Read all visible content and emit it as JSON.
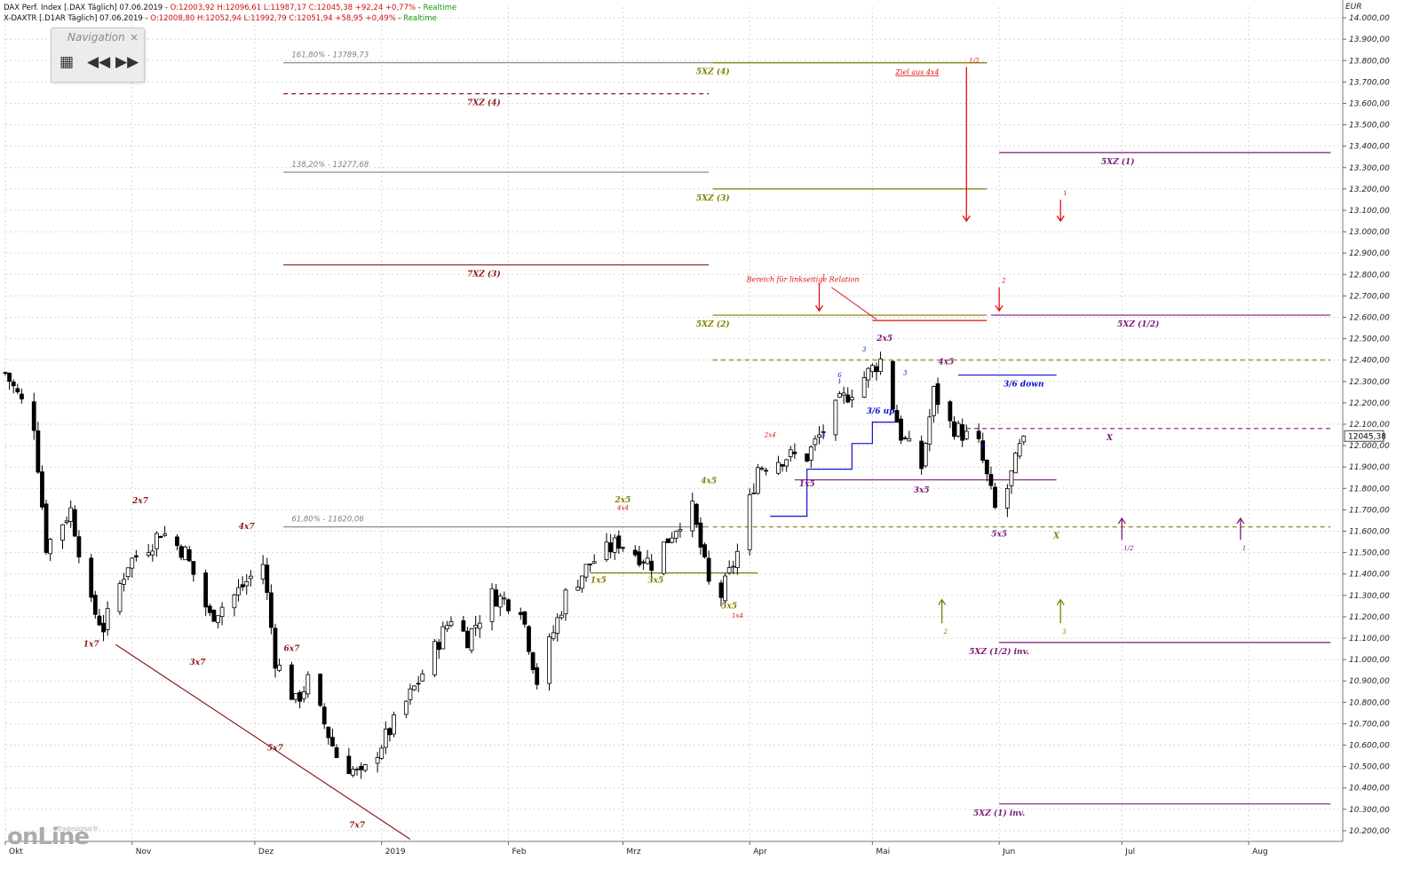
{
  "header": {
    "line1_prefix": "DAX Perf. Index [.DAX Täglich] 07.06.2019 - ",
    "line1_values": "O:12003,92 H:12096,61 L:11987,17 C:12045,38 +92,24 +0,77%",
    "line1_sep": " - ",
    "line1_status": "Realtime",
    "line2_prefix": "X-DAXTR [.D1AR Täglich] 07.06.2019 - ",
    "line2_values": "O:12008,80 H:12052,94 L:11992,79 C:12051,94 +58,95 +0,49%",
    "line2_sep": " - ",
    "line2_status": "Realtime"
  },
  "navigation": {
    "title": "Navigation",
    "close": "×",
    "grid": "▦",
    "back": "◀◀",
    "forward": "▶▶"
  },
  "logo": {
    "main": "onLine",
    "sub": "Tradesignal®"
  },
  "colors": {
    "olive": "#7f7f00",
    "darkred": "#8b1a1a",
    "purple": "#7a1a7a",
    "blue": "#1010d0",
    "red": "#e01010",
    "gray": "#808080"
  },
  "chart_data": {
    "type": "candlestick",
    "currency": "EUR",
    "current_price": "12045,38",
    "ylim": [
      10150,
      14050
    ],
    "y_ticks": [
      "10.200,00",
      "10.300,00",
      "10.400,00",
      "10.500,00",
      "10.600,00",
      "10.700,00",
      "10.800,00",
      "10.900,00",
      "11.000,00",
      "11.100,00",
      "11.200,00",
      "11.300,00",
      "11.400,00",
      "11.500,00",
      "11.600,00",
      "11.700,00",
      "11.800,00",
      "11.900,00",
      "12.000,00",
      "12.100,00",
      "12.200,00",
      "12.300,00",
      "12.400,00",
      "12.500,00",
      "12.600,00",
      "12.700,00",
      "12.800,00",
      "12.900,00",
      "13.000,00",
      "13.100,00",
      "13.200,00",
      "13.300,00",
      "13.400,00",
      "13.500,00",
      "13.600,00",
      "13.700,00",
      "13.800,00",
      "13.900,00",
      "14.000,00"
    ],
    "x_labels": [
      "Okt",
      "Nov",
      "Dez",
      "2019",
      "Feb",
      "Mrz",
      "Apr",
      "Mai",
      "Jun",
      "Jul",
      "Aug"
    ],
    "x_label_dates": [
      "2018-10-01",
      "2018-11-01",
      "2018-12-01",
      "2019-01-01",
      "2019-02-01",
      "2019-03-01",
      "2019-04-01",
      "2019-05-01",
      "2019-06-01",
      "2019-07-01",
      "2019-08-01"
    ],
    "x_range": [
      "2018-10-01",
      "2019-08-24"
    ],
    "grid": true,
    "horizontal_levels": [
      {
        "label": "161,80% - 13789,73",
        "value": 13790,
        "from": "2018-12-08",
        "to": "2019-05-29",
        "color": "gray",
        "style": "solid",
        "label_at": "2018-12-10"
      },
      {
        "label": "5XZ (4)",
        "value": 13790,
        "from": "2019-03-23",
        "to": "2019-05-29",
        "color": "olive",
        "style": "solid",
        "label_at": "2019-03-23"
      },
      {
        "label": "7XZ (4)",
        "value": 13645,
        "from": "2018-12-08",
        "to": "2019-03-22",
        "color": "darkred",
        "style": "dashed",
        "label_at": "2019-01-26"
      },
      {
        "label": "5XZ (1)",
        "value": 13370,
        "from": "2019-06-01",
        "to": "2019-08-21",
        "color": "purple",
        "style": "solid",
        "label_at": "2019-06-30"
      },
      {
        "label": "138,20% - 13277,68",
        "value": 13278,
        "from": "2018-12-08",
        "to": "2019-03-22",
        "color": "gray",
        "style": "solid",
        "label_at": "2018-12-10"
      },
      {
        "label": "5XZ (3)",
        "value": 13200,
        "from": "2019-03-23",
        "to": "2019-05-29",
        "color": "olive",
        "style": "solid",
        "label_at": "2019-03-23"
      },
      {
        "label": "7XZ (3)",
        "value": 12845,
        "from": "2018-12-08",
        "to": "2019-03-22",
        "color": "darkred",
        "style": "solid",
        "label_at": "2019-01-26"
      },
      {
        "label": "5XZ (2)",
        "value": 12610,
        "from": "2019-03-23",
        "to": "2019-05-29",
        "color": "olive",
        "style": "solid",
        "label_at": "2019-03-23"
      },
      {
        "label": "5XZ (1/2)",
        "value": 12610,
        "from": "2019-05-30",
        "to": "2019-08-21",
        "color": "purple",
        "style": "solid",
        "label_at": "2019-07-05"
      },
      {
        "label": "",
        "value": 12400,
        "from": "2019-03-23",
        "to": "2019-08-21",
        "color": "olive",
        "style": "dashed",
        "label_at": ""
      },
      {
        "label": "3/6 down",
        "value": 12330,
        "from": "2019-05-22",
        "to": "2019-06-15",
        "color": "blue",
        "style": "solid",
        "label_at": "2019-06-07"
      },
      {
        "label": "X",
        "value": 12080,
        "from": "2019-05-22",
        "to": "2019-08-21",
        "color": "purple",
        "style": "dashed",
        "label_at": "2019-06-28"
      },
      {
        "label": "",
        "value": 11840,
        "from": "2019-04-12",
        "to": "2019-06-15",
        "color": "purple",
        "style": "solid",
        "label_at": ""
      },
      {
        "label": "61,80% - 11620,06",
        "value": 11620,
        "from": "2018-12-08",
        "to": "2019-03-22",
        "color": "gray",
        "style": "solid",
        "label_at": "2018-12-10"
      },
      {
        "label": "X",
        "value": 11620,
        "from": "2019-03-23",
        "to": "2019-08-21",
        "color": "olive",
        "style": "dashed",
        "label_at": "2019-06-15"
      },
      {
        "label": "",
        "value": 11405,
        "from": "2019-02-21",
        "to": "2019-04-03",
        "color": "olive",
        "style": "solid",
        "label_at": ""
      },
      {
        "label": "5XZ (1/2) inv.",
        "value": 11080,
        "from": "2019-06-01",
        "to": "2019-08-21",
        "color": "purple",
        "style": "solid",
        "label_at": "2019-06-01"
      },
      {
        "label": "5XZ (1) inv.",
        "value": 10325,
        "from": "2019-06-01",
        "to": "2019-08-21",
        "color": "purple",
        "style": "solid",
        "label_at": "2019-06-01"
      }
    ],
    "trendline": {
      "from": [
        "2018-10-28",
        11070
      ],
      "to": [
        "2019-01-08",
        10160
      ],
      "color": "darkred"
    },
    "blue_step": [
      [
        "2019-04-06",
        11670
      ],
      [
        "2019-04-15",
        11670
      ],
      [
        "2019-04-15",
        11890
      ],
      [
        "2019-04-26",
        11890
      ],
      [
        "2019-04-26",
        12010
      ],
      [
        "2019-05-01",
        12010
      ],
      [
        "2019-05-01",
        12110
      ],
      [
        "2019-05-08",
        12110
      ]
    ],
    "red_level": {
      "from": [
        "2019-05-01",
        12585
      ],
      "to": [
        "2019-05-29",
        12585
      ]
    },
    "arrows": [
      {
        "label": "1",
        "date": "2019-04-18",
        "from": 12760,
        "to": 12630,
        "color": "red",
        "dir": "down"
      },
      {
        "label": "2",
        "date": "2019-06-01",
        "from": 12740,
        "to": 12630,
        "color": "red",
        "dir": "down"
      },
      {
        "label": "1",
        "date": "2019-06-16",
        "from": 13150,
        "to": 13050,
        "color": "red",
        "dir": "down"
      },
      {
        "label": "1/2",
        "date": "2019-05-24",
        "from": 13770,
        "to": 13050,
        "color": "red",
        "dir": "down"
      },
      {
        "label": "2",
        "date": "2019-05-18",
        "from": 11170,
        "to": 11280,
        "color": "olive",
        "dir": "up"
      },
      {
        "label": "3",
        "date": "2019-06-16",
        "from": 11170,
        "to": 11280,
        "color": "olive",
        "dir": "up"
      },
      {
        "label": "1/2",
        "date": "2019-07-01",
        "from": 11560,
        "to": 11660,
        "color": "purple",
        "dir": "up"
      },
      {
        "label": "1",
        "date": "2019-07-30",
        "from": 11560,
        "to": 11660,
        "color": "purple",
        "dir": "up"
      }
    ],
    "annotations": [
      {
        "text": "Ziel aus 4x4",
        "date": "2019-05-12",
        "value": 13735,
        "color": "red",
        "underline": true,
        "size": 8
      },
      {
        "text": "Bereich für linkseitige Relation",
        "date": "2019-04-14",
        "value": 12765,
        "color": "red",
        "size": 8
      },
      {
        "text": "2x7",
        "date": "2018-11-03",
        "value": 11730,
        "color": "darkred",
        "size": 9
      },
      {
        "text": "4x7",
        "date": "2018-11-29",
        "value": 11610,
        "color": "darkred",
        "size": 9
      },
      {
        "text": "1x7",
        "date": "2018-10-22",
        "value": 11060,
        "color": "darkred",
        "size": 9
      },
      {
        "text": "3x7",
        "date": "2018-11-17",
        "value": 10975,
        "color": "darkred",
        "size": 9
      },
      {
        "text": "6x7",
        "date": "2018-12-10",
        "value": 11040,
        "color": "darkred",
        "size": 9
      },
      {
        "text": "5x7",
        "date": "2018-12-06",
        "value": 10575,
        "color": "darkred",
        "size": 9
      },
      {
        "text": "7x7",
        "date": "2018-12-26",
        "value": 10215,
        "color": "darkred",
        "size": 9
      },
      {
        "text": "2x5",
        "date": "2019-03-01",
        "value": 11735,
        "color": "olive",
        "size": 9
      },
      {
        "text": "4x4",
        "date": "2019-03-01",
        "value": 11700,
        "color": "red",
        "size": 7
      },
      {
        "text": "4x5",
        "date": "2019-03-22",
        "value": 11825,
        "color": "olive",
        "size": 9
      },
      {
        "text": "1x5",
        "date": "2019-02-23",
        "value": 11360,
        "color": "olive",
        "size": 9
      },
      {
        "text": "3x5",
        "date": "2019-03-09",
        "value": 11360,
        "color": "olive",
        "size": 9
      },
      {
        "text": "5x5",
        "date": "2019-03-27",
        "value": 11240,
        "color": "olive",
        "size": 9
      },
      {
        "text": "1x4",
        "date": "2019-03-29",
        "value": 11195,
        "color": "red",
        "size": 7
      },
      {
        "text": "2x4",
        "date": "2019-04-06",
        "value": 12040,
        "color": "red",
        "size": 7
      },
      {
        "text": "1x5",
        "date": "2019-04-15",
        "value": 11810,
        "color": "purple",
        "size": 9
      },
      {
        "text": "3/6 up",
        "date": "2019-05-03",
        "value": 12150,
        "color": "blue",
        "size": 9
      },
      {
        "text": "2x5",
        "date": "2019-05-04",
        "value": 12490,
        "color": "purple",
        "size": 9
      },
      {
        "text": "4x5",
        "date": "2019-05-19",
        "value": 12380,
        "color": "purple",
        "size": 9
      },
      {
        "text": "3x5",
        "date": "2019-05-13",
        "value": 11780,
        "color": "purple",
        "size": 9
      },
      {
        "text": "5x5",
        "date": "2019-06-01",
        "value": 11575,
        "color": "purple",
        "size": 9
      },
      {
        "text": "6",
        "date": "2019-04-23",
        "value": 12320,
        "color": "blue",
        "size": 7
      },
      {
        "text": "1",
        "date": "2019-04-23",
        "value": 12290,
        "color": "blue",
        "size": 7
      },
      {
        "text": "3",
        "date": "2019-04-19",
        "value": 12040,
        "color": "blue",
        "size": 7
      },
      {
        "text": "3",
        "date": "2019-04-29",
        "value": 12440,
        "color": "blue",
        "size": 7
      },
      {
        "text": "3",
        "date": "2019-05-09",
        "value": 12330,
        "color": "blue",
        "size": 7
      },
      {
        "text": "6",
        "date": "2019-05-28",
        "value": 11985,
        "color": "blue",
        "size": 7
      }
    ],
    "anchors": [
      {
        "date": "2018-10-01",
        "value": 12340
      },
      {
        "date": "2018-10-08",
        "value": 12100
      },
      {
        "date": "2018-10-11",
        "value": 11530
      },
      {
        "date": "2018-10-17",
        "value": 11700
      },
      {
        "date": "2018-10-22",
        "value": 11250
      },
      {
        "date": "2018-10-25",
        "value": 11150
      },
      {
        "date": "2018-10-31",
        "value": 11450
      },
      {
        "date": "2018-11-06",
        "value": 11550
      },
      {
        "date": "2018-11-08",
        "value": 11600
      },
      {
        "date": "2018-11-14",
        "value": 11500
      },
      {
        "date": "2018-11-20",
        "value": 11200
      },
      {
        "date": "2018-11-26",
        "value": 11300
      },
      {
        "date": "2018-12-03",
        "value": 11450
      },
      {
        "date": "2018-12-06",
        "value": 11000
      },
      {
        "date": "2018-12-11",
        "value": 10800
      },
      {
        "date": "2018-12-14",
        "value": 10900
      },
      {
        "date": "2018-12-18",
        "value": 10700
      },
      {
        "date": "2018-12-21",
        "value": 10550
      },
      {
        "date": "2018-12-27",
        "value": 10450
      },
      {
        "date": "2019-01-04",
        "value": 10700
      },
      {
        "date": "2019-01-10",
        "value": 10900
      },
      {
        "date": "2019-01-18",
        "value": 11200
      },
      {
        "date": "2019-01-22",
        "value": 11100
      },
      {
        "date": "2019-01-28",
        "value": 11300
      },
      {
        "date": "2019-02-04",
        "value": 11250
      },
      {
        "date": "2019-02-08",
        "value": 10900
      },
      {
        "date": "2019-02-15",
        "value": 11300
      },
      {
        "date": "2019-02-21",
        "value": 11450
      },
      {
        "date": "2019-02-28",
        "value": 11550
      },
      {
        "date": "2019-03-08",
        "value": 11450
      },
      {
        "date": "2019-03-15",
        "value": 11650
      },
      {
        "date": "2019-03-18",
        "value": 11700
      },
      {
        "date": "2019-03-22",
        "value": 11350
      },
      {
        "date": "2019-03-25",
        "value": 11300
      },
      {
        "date": "2019-03-29",
        "value": 11500
      },
      {
        "date": "2019-04-03",
        "value": 11900
      },
      {
        "date": "2019-04-10",
        "value": 11950
      },
      {
        "date": "2019-04-15",
        "value": 11950
      },
      {
        "date": "2019-04-23",
        "value": 12200
      },
      {
        "date": "2019-05-03",
        "value": 12400
      },
      {
        "date": "2019-05-08",
        "value": 12050
      },
      {
        "date": "2019-05-13",
        "value": 11900
      },
      {
        "date": "2019-05-16",
        "value": 12250
      },
      {
        "date": "2019-05-20",
        "value": 12100
      },
      {
        "date": "2019-05-27",
        "value": 12000
      },
      {
        "date": "2019-05-31",
        "value": 11700
      },
      {
        "date": "2019-06-03",
        "value": 11800
      },
      {
        "date": "2019-06-07",
        "value": 12045
      }
    ]
  }
}
